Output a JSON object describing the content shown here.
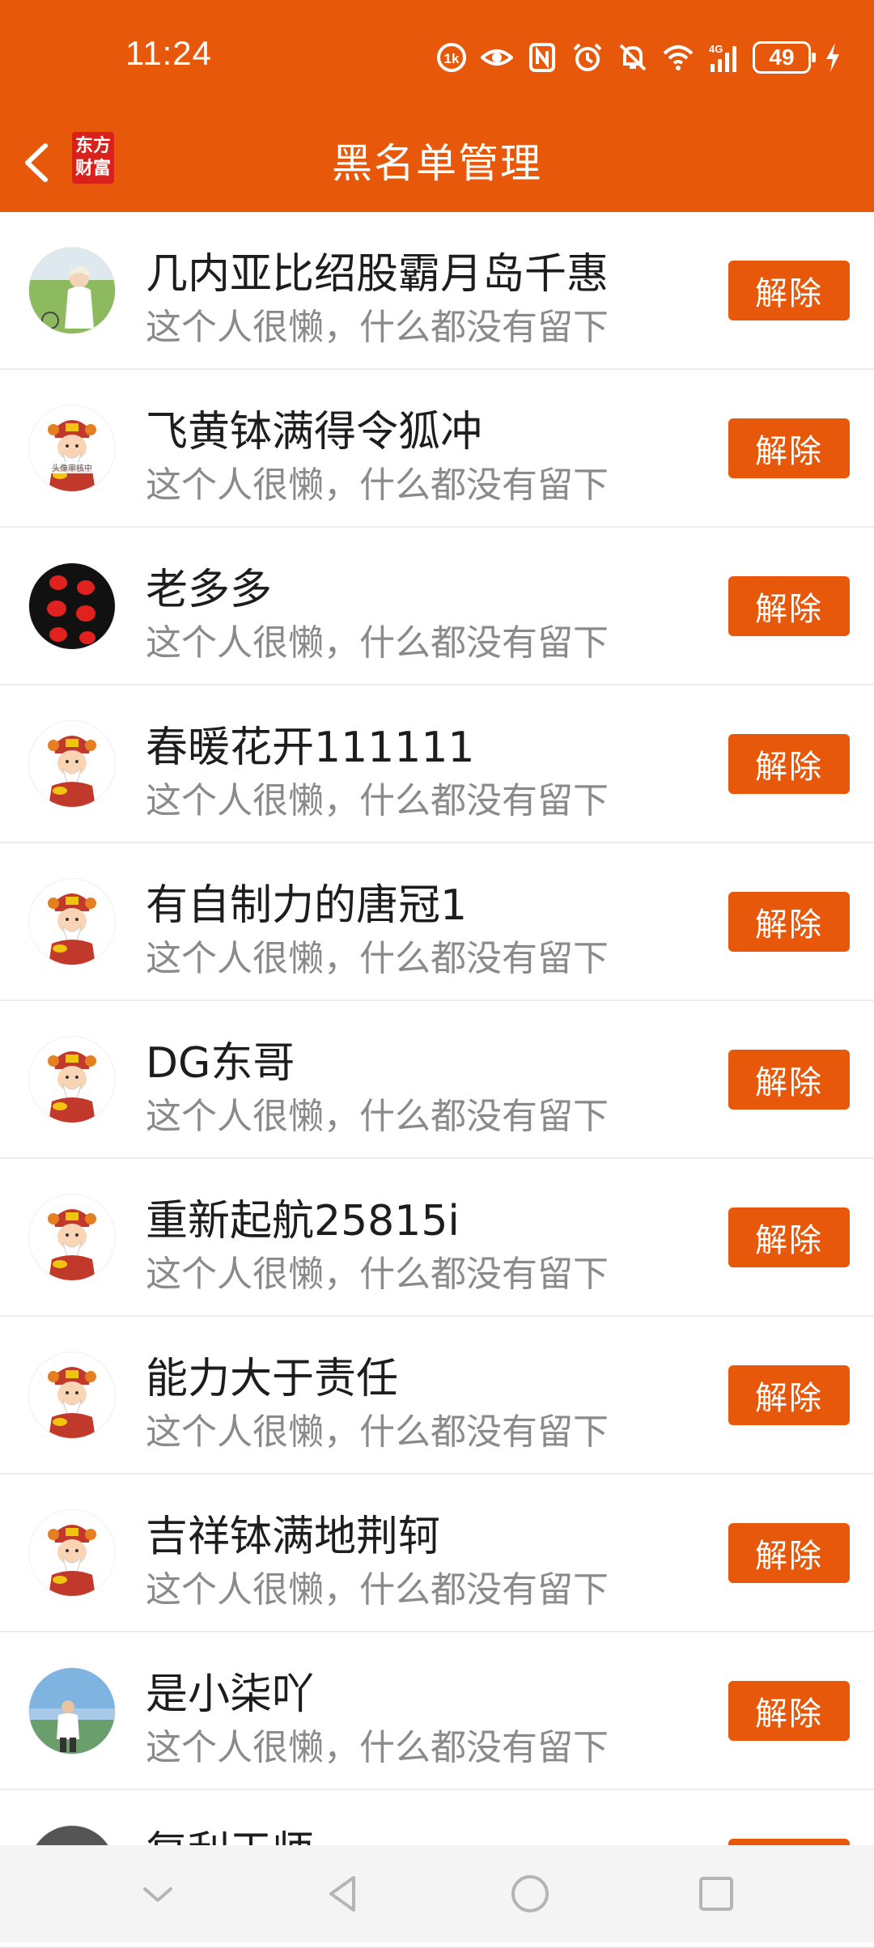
{
  "status_bar": {
    "time": "11:24",
    "battery": "49",
    "icons": [
      "nfc-small-icon",
      "eye-icon",
      "nfc-icon",
      "alarm-icon",
      "mute-icon",
      "wifi-icon",
      "signal-4g-icon",
      "charging-icon"
    ]
  },
  "header": {
    "title": "黑名单管理",
    "brand_logo_line1": "东方",
    "brand_logo_line2": "财富"
  },
  "list": {
    "items": [
      {
        "name": "几内亚比绍股霸月岛千惠",
        "bio": "这个人很懒，什么都没有留下",
        "button": "解除",
        "avatar": "photo-girl"
      },
      {
        "name": "飞黄钵满得令狐冲",
        "bio": "这个人很懒，什么都没有留下",
        "button": "解除",
        "avatar": "caishen-review"
      },
      {
        "name": "老多多",
        "bio": "这个人很懒，什么都没有留下",
        "button": "解除",
        "avatar": "lanterns"
      },
      {
        "name": "春暖花开111111",
        "bio": "这个人很懒，什么都没有留下",
        "button": "解除",
        "avatar": "caishen"
      },
      {
        "name": "有自制力的唐冠1",
        "bio": "这个人很懒，什么都没有留下",
        "button": "解除",
        "avatar": "caishen"
      },
      {
        "name": "DG东哥",
        "bio": "这个人很懒，什么都没有留下",
        "button": "解除",
        "avatar": "caishen"
      },
      {
        "name": "重新起航25815i",
        "bio": "这个人很懒，什么都没有留下",
        "button": "解除",
        "avatar": "caishen"
      },
      {
        "name": "能力大于责任",
        "bio": "这个人很懒，什么都没有留下",
        "button": "解除",
        "avatar": "caishen"
      },
      {
        "name": "吉祥钵满地荆轲",
        "bio": "这个人很懒，什么都没有留下",
        "button": "解除",
        "avatar": "caishen"
      },
      {
        "name": "是小柒吖",
        "bio": "这个人很懒，什么都没有留下",
        "button": "解除",
        "avatar": "photo-man"
      },
      {
        "name": "复利王师",
        "bio": "",
        "button": "解除",
        "avatar": "dark"
      }
    ]
  },
  "colors": {
    "accent": "#E8580A",
    "text_primary": "#1d1d1d",
    "text_secondary": "#8a8a8a",
    "divider": "#EDEDED"
  },
  "system_nav": {
    "icons": [
      "chevron-down-icon",
      "back-triangle-icon",
      "home-circle-icon",
      "recents-square-icon"
    ]
  }
}
